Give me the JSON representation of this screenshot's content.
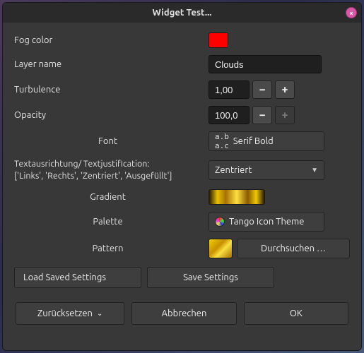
{
  "title": "Widget Test...",
  "rows": {
    "fog_color": {
      "label": "Fog color",
      "value_hex": "#ff0000"
    },
    "layer_name": {
      "label": "Layer name",
      "value": "Clouds"
    },
    "turbulence": {
      "label": "Turbulence",
      "value": "1,00"
    },
    "opacity": {
      "label": "Opacity",
      "value": "100,0"
    },
    "font": {
      "label": "Font",
      "prefix": "a.b\na.c",
      "value": "Serif Bold"
    },
    "justification": {
      "label": "Textausrichtung/ Textjustification:\n['Links', 'Rechts', 'Zentriert', 'Ausgefüllt']",
      "value": "Zentriert",
      "options": [
        "Links",
        "Rechts",
        "Zentriert",
        "Ausgefüllt"
      ]
    },
    "gradient": {
      "label": "Gradient"
    },
    "palette": {
      "label": "Palette",
      "value": "Tango Icon Theme"
    },
    "pattern": {
      "label": "Pattern",
      "browse": "Durchsuchen …"
    }
  },
  "buttons": {
    "load_saved": "Load Saved Settings",
    "save": "Save Settings",
    "reset": "Zurücksetzen",
    "cancel": "Abbrechen",
    "ok": "OK"
  },
  "glyphs": {
    "minus": "−",
    "plus": "+",
    "dropdown": "▼",
    "chevron_down": "⌄",
    "close": "×"
  }
}
